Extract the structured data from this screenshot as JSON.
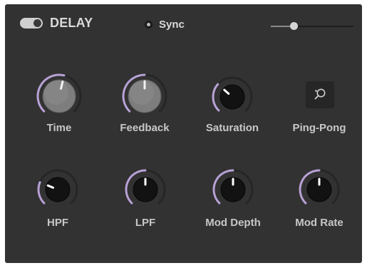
{
  "header": {
    "title": "DELAY",
    "sync_label": "Sync",
    "power_on": true,
    "sync_selected": false,
    "mix_level": 0.28
  },
  "colors": {
    "accent_arc": "#b8a2d6",
    "panel": "#323232"
  },
  "knobs_row1": [
    {
      "label": "Time",
      "style": "large-grey",
      "value": 0.55
    },
    {
      "label": "Feedback",
      "style": "large-grey",
      "value": 0.5
    },
    {
      "label": "Saturation",
      "style": "dark",
      "value": 0.32
    }
  ],
  "pingpong": {
    "label": "Ping-Pong",
    "icon": "ping-pong-paddle-icon"
  },
  "knobs_row2": [
    {
      "label": "HPF",
      "style": "dark",
      "value": 0.25
    },
    {
      "label": "LPF",
      "style": "dark",
      "value": 0.5
    },
    {
      "label": "Mod Depth",
      "style": "dark",
      "value": 0.5
    },
    {
      "label": "Mod Rate",
      "style": "dark",
      "value": 0.5
    }
  ]
}
